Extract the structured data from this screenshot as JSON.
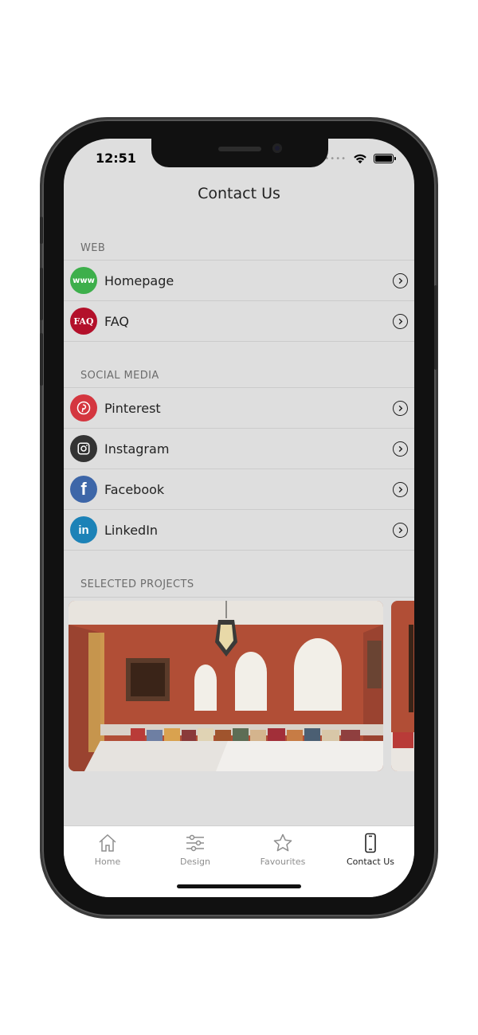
{
  "status": {
    "time": "12:51"
  },
  "nav": {
    "title": "Contact Us"
  },
  "sections": {
    "web": {
      "header": "WEB",
      "items": [
        {
          "label": "Homepage",
          "icon": "www-icon",
          "icon_text": "www",
          "color": "#3daf4b"
        },
        {
          "label": "FAQ",
          "icon": "faq-icon",
          "icon_text": "FAQ",
          "color": "#b3102a"
        }
      ]
    },
    "social": {
      "header": "SOCIAL MEDIA",
      "items": [
        {
          "label": "Pinterest",
          "icon": "pinterest-icon",
          "color": "#d4363f"
        },
        {
          "label": "Instagram",
          "icon": "instagram-icon",
          "color": "#333333"
        },
        {
          "label": "Facebook",
          "icon": "facebook-icon",
          "icon_text": "f",
          "color": "#3d66a8"
        },
        {
          "label": "LinkedIn",
          "icon": "linkedin-icon",
          "icon_text": "in",
          "color": "#1c82b7"
        }
      ]
    },
    "projects": {
      "header": "SELECTED PROJECTS"
    }
  },
  "tabs": [
    {
      "label": "Home",
      "icon": "home-icon",
      "active": false
    },
    {
      "label": "Design",
      "icon": "sliders-icon",
      "active": false
    },
    {
      "label": "Favourites",
      "icon": "star-icon",
      "active": false
    },
    {
      "label": "Contact Us",
      "icon": "phone-icon",
      "active": true
    }
  ],
  "colors": {
    "background": "#dedede",
    "separator": "#cbcbcb",
    "wall": "#b5503a",
    "tab_inactive": "#8e8e8e",
    "tab_active": "#222222"
  }
}
